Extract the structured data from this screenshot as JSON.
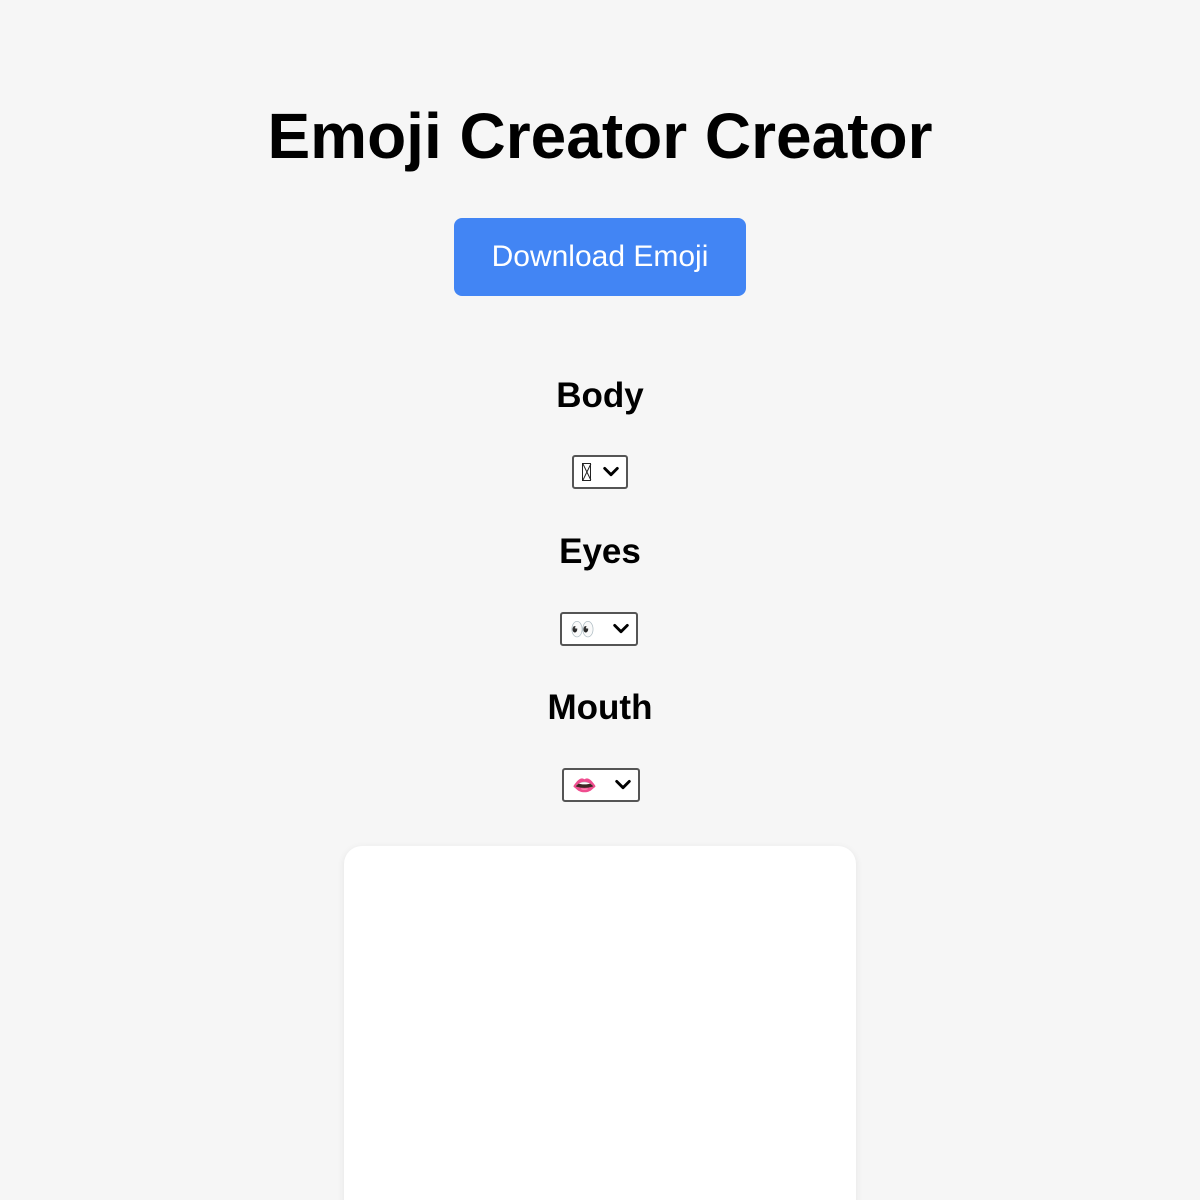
{
  "header": {
    "title": "Emoji Creator Creator"
  },
  "toolbar": {
    "download_label": "Download Emoji"
  },
  "controls": {
    "body": {
      "label": "Body",
      "selected": ""
    },
    "eyes": {
      "label": "Eyes",
      "selected": "👀"
    },
    "mouth": {
      "label": "Mouth",
      "selected": "👄"
    }
  },
  "theme": {
    "accent": "#4285f4",
    "background": "#f6f6f6",
    "canvas": "#ffffff"
  },
  "icons": {
    "dropdown": "chevron-down-icon"
  }
}
